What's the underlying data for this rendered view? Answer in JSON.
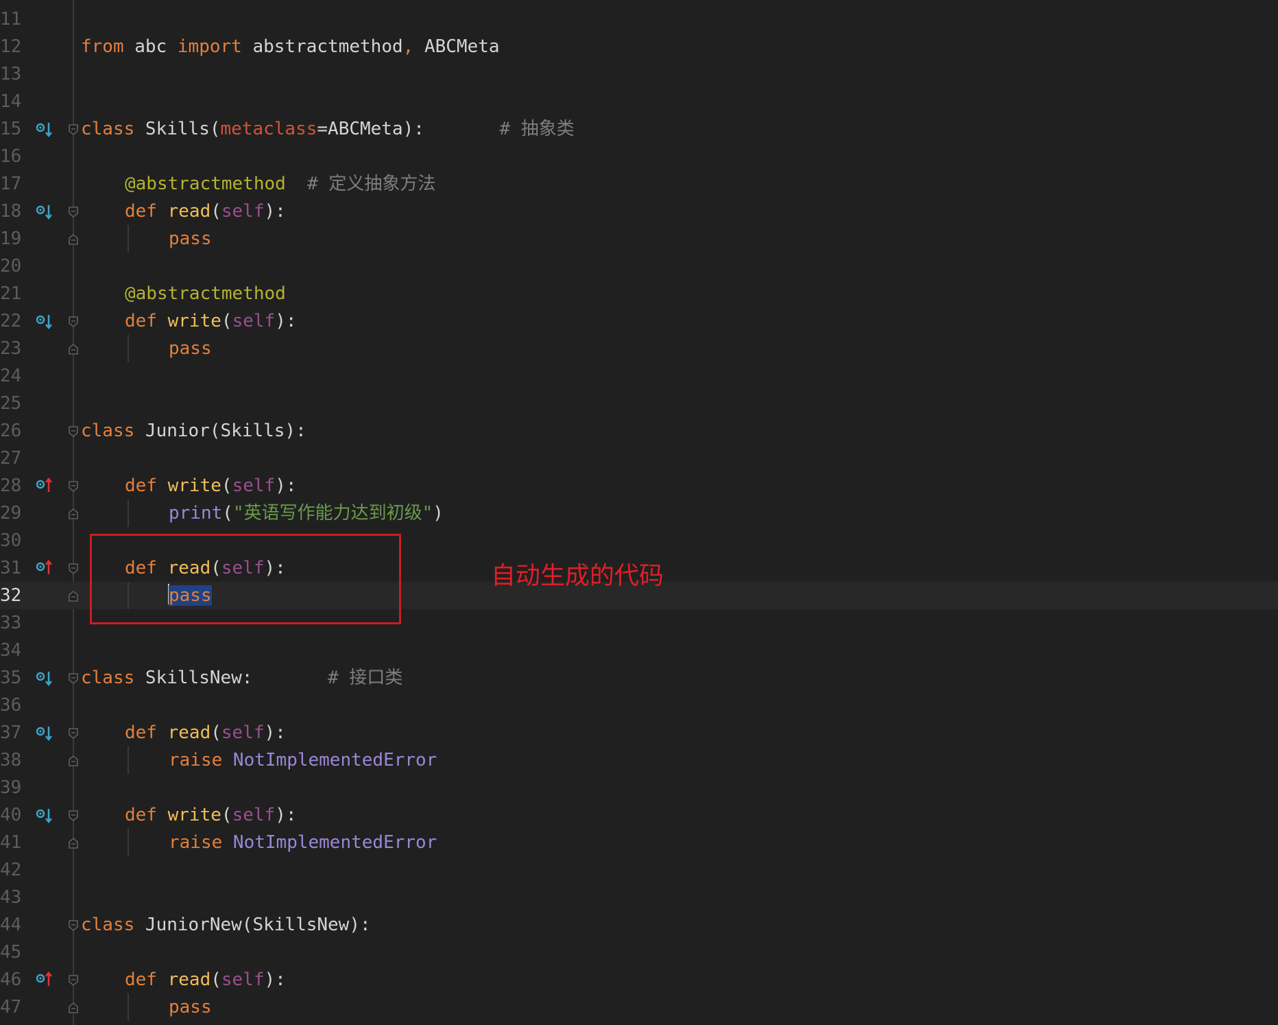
{
  "editor": {
    "lines": [
      {
        "n": "11",
        "tokens": []
      },
      {
        "n": "12",
        "tokens": [
          [
            "kw",
            "from "
          ],
          [
            "txt",
            "abc "
          ],
          [
            "kw",
            "import "
          ],
          [
            "txt",
            "abstractmethod"
          ],
          [
            "kw",
            ", "
          ],
          [
            "txt",
            "ABCMeta"
          ]
        ]
      },
      {
        "n": "13",
        "tokens": []
      },
      {
        "n": "14",
        "tokens": []
      },
      {
        "n": "15",
        "marker": "down",
        "fold": "open",
        "tokens": [
          [
            "kw",
            "class "
          ],
          [
            "txt",
            "Skills("
          ],
          [
            "param",
            "metaclass"
          ],
          [
            "txt",
            "=ABCMeta):       "
          ],
          [
            "cmt",
            "# 抽象类"
          ]
        ]
      },
      {
        "n": "16",
        "tokens": []
      },
      {
        "n": "17",
        "indent": 1,
        "tokens": [
          [
            "dec",
            "@abstractmethod  "
          ],
          [
            "cmt",
            "# 定义抽象方法"
          ]
        ]
      },
      {
        "n": "18",
        "marker": "down",
        "fold": "open",
        "indent": 1,
        "tokens": [
          [
            "kw",
            "def "
          ],
          [
            "fn",
            "read"
          ],
          [
            "txt",
            "("
          ],
          [
            "self",
            "self"
          ],
          [
            "txt",
            "):"
          ]
        ]
      },
      {
        "n": "19",
        "fold": "close",
        "indent": 2,
        "tokens": [
          [
            "kw",
            "pass"
          ]
        ]
      },
      {
        "n": "20",
        "tokens": []
      },
      {
        "n": "21",
        "indent": 1,
        "tokens": [
          [
            "dec",
            "@abstractmethod"
          ]
        ]
      },
      {
        "n": "22",
        "marker": "down",
        "fold": "open",
        "indent": 1,
        "tokens": [
          [
            "kw",
            "def "
          ],
          [
            "fn",
            "write"
          ],
          [
            "txt",
            "("
          ],
          [
            "self",
            "self"
          ],
          [
            "txt",
            "):"
          ]
        ]
      },
      {
        "n": "23",
        "fold": "close",
        "indent": 2,
        "tokens": [
          [
            "kw",
            "pass"
          ]
        ]
      },
      {
        "n": "24",
        "tokens": []
      },
      {
        "n": "25",
        "tokens": []
      },
      {
        "n": "26",
        "fold": "open",
        "tokens": [
          [
            "kw",
            "class "
          ],
          [
            "txt",
            "Junior(Skills):"
          ]
        ]
      },
      {
        "n": "27",
        "tokens": []
      },
      {
        "n": "28",
        "marker": "up",
        "fold": "open",
        "indent": 1,
        "tokens": [
          [
            "kw",
            "def "
          ],
          [
            "fn",
            "write"
          ],
          [
            "txt",
            "("
          ],
          [
            "self",
            "self"
          ],
          [
            "txt",
            "):"
          ]
        ]
      },
      {
        "n": "29",
        "fold": "close",
        "indent": 2,
        "tokens": [
          [
            "blt",
            "print"
          ],
          [
            "txt",
            "("
          ],
          [
            "str",
            "\"英语写作能力达到初级\""
          ],
          [
            "txt",
            ")"
          ]
        ]
      },
      {
        "n": "30",
        "tokens": []
      },
      {
        "n": "31",
        "marker": "up",
        "fold": "open",
        "indent": 1,
        "tokens": [
          [
            "kw",
            "def "
          ],
          [
            "fn",
            "read"
          ],
          [
            "txt",
            "("
          ],
          [
            "self",
            "self"
          ],
          [
            "txt",
            "):"
          ]
        ]
      },
      {
        "n": "32",
        "fold": "close",
        "indent": 2,
        "current": true,
        "tokens": [
          [
            "caret",
            ""
          ],
          [
            "kw sel",
            "pass"
          ]
        ]
      },
      {
        "n": "33",
        "tokens": []
      },
      {
        "n": "34",
        "tokens": []
      },
      {
        "n": "35",
        "marker": "down",
        "fold": "open",
        "tokens": [
          [
            "kw",
            "class "
          ],
          [
            "txt",
            "SkillsNew:       "
          ],
          [
            "cmt",
            "# 接口类"
          ]
        ]
      },
      {
        "n": "36",
        "tokens": []
      },
      {
        "n": "37",
        "marker": "down",
        "fold": "open",
        "indent": 1,
        "tokens": [
          [
            "kw",
            "def "
          ],
          [
            "fn",
            "read"
          ],
          [
            "txt",
            "("
          ],
          [
            "self",
            "self"
          ],
          [
            "txt",
            "):"
          ]
        ]
      },
      {
        "n": "38",
        "fold": "close",
        "indent": 2,
        "tokens": [
          [
            "kw",
            "raise "
          ],
          [
            "blt",
            "NotImplementedError"
          ]
        ]
      },
      {
        "n": "39",
        "tokens": []
      },
      {
        "n": "40",
        "marker": "down",
        "fold": "open",
        "indent": 1,
        "tokens": [
          [
            "kw",
            "def "
          ],
          [
            "fn",
            "write"
          ],
          [
            "txt",
            "("
          ],
          [
            "self",
            "self"
          ],
          [
            "txt",
            "):"
          ]
        ]
      },
      {
        "n": "41",
        "fold": "close",
        "indent": 2,
        "tokens": [
          [
            "kw",
            "raise "
          ],
          [
            "blt",
            "NotImplementedError"
          ]
        ]
      },
      {
        "n": "42",
        "tokens": []
      },
      {
        "n": "43",
        "tokens": []
      },
      {
        "n": "44",
        "fold": "open",
        "tokens": [
          [
            "kw",
            "class "
          ],
          [
            "txt",
            "JuniorNew(SkillsNew):"
          ]
        ]
      },
      {
        "n": "45",
        "tokens": []
      },
      {
        "n": "46",
        "marker": "up",
        "fold": "open",
        "indent": 1,
        "tokens": [
          [
            "kw",
            "def "
          ],
          [
            "fn",
            "read"
          ],
          [
            "txt",
            "("
          ],
          [
            "self",
            "self"
          ],
          [
            "txt",
            "):"
          ]
        ]
      },
      {
        "n": "47",
        "fold": "close",
        "indent": 2,
        "tokens": [
          [
            "kw",
            "pass"
          ]
        ]
      }
    ]
  },
  "annotation": {
    "text": "自动生成的代码",
    "color": "#e01e26"
  },
  "colors": {
    "background": "#202020",
    "keyword": "#e47f3b",
    "function": "#f2bd5a",
    "self": "#9a4f8f",
    "decorator": "#b3b42f",
    "string": "#6a9a4b",
    "comment": "#7e7e7e",
    "builtin": "#9a87d8",
    "marker_icon": "#3fa3c7",
    "override_arrow_up": "#e0323a"
  }
}
